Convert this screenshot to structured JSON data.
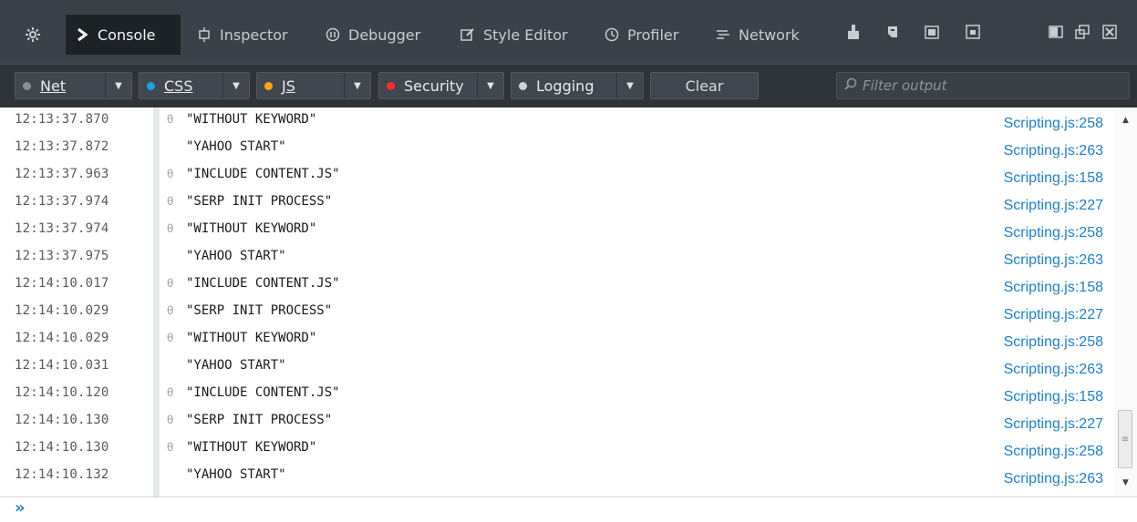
{
  "tabs": [
    {
      "name": "settings",
      "label": "",
      "icon": "gear-icon"
    },
    {
      "name": "console",
      "label": "Console",
      "icon": "chevron-right-icon",
      "selected": true
    },
    {
      "name": "inspector",
      "label": "Inspector",
      "icon": "inspector-icon"
    },
    {
      "name": "debugger",
      "label": "Debugger",
      "icon": "debugger-icon"
    },
    {
      "name": "style-editor",
      "label": "Style Editor",
      "icon": "pencil-icon"
    },
    {
      "name": "profiler",
      "label": "Profiler",
      "icon": "clock-icon"
    },
    {
      "name": "network",
      "label": "Network",
      "icon": "network-icon"
    }
  ],
  "filters": {
    "net": {
      "label": "Net",
      "dot_color": "#8b9096"
    },
    "css": {
      "label": "CSS",
      "dot_color": "#1ba1e2"
    },
    "js": {
      "label": "JS",
      "dot_color": "#ffa31a"
    },
    "security": {
      "label": "Security",
      "dot_color": "#ff2d2d"
    },
    "logging": {
      "label": "Logging",
      "dot_color": "#cfd3d6"
    }
  },
  "clear_label": "Clear",
  "filter_placeholder": "Filter output",
  "log": [
    {
      "time": "12:13:37.870",
      "icon": true,
      "message": "\"WITHOUT KEYWORD\"",
      "source": "Scripting.js:258"
    },
    {
      "time": "12:13:37.872",
      "icon": false,
      "message": "\"YAHOO START\"",
      "source": "Scripting.js:263"
    },
    {
      "time": "12:13:37.963",
      "icon": true,
      "message": "\"INCLUDE CONTENT.JS\"",
      "source": "Scripting.js:158"
    },
    {
      "time": "12:13:37.974",
      "icon": true,
      "message": "\"SERP INIT PROCESS\"",
      "source": "Scripting.js:227"
    },
    {
      "time": "12:13:37.974",
      "icon": true,
      "message": "\"WITHOUT KEYWORD\"",
      "source": "Scripting.js:258"
    },
    {
      "time": "12:13:37.975",
      "icon": false,
      "message": "\"YAHOO START\"",
      "source": "Scripting.js:263"
    },
    {
      "time": "12:14:10.017",
      "icon": true,
      "message": "\"INCLUDE CONTENT.JS\"",
      "source": "Scripting.js:158"
    },
    {
      "time": "12:14:10.029",
      "icon": true,
      "message": "\"SERP INIT PROCESS\"",
      "source": "Scripting.js:227"
    },
    {
      "time": "12:14:10.029",
      "icon": true,
      "message": "\"WITHOUT KEYWORD\"",
      "source": "Scripting.js:258"
    },
    {
      "time": "12:14:10.031",
      "icon": false,
      "message": "\"YAHOO START\"",
      "source": "Scripting.js:263"
    },
    {
      "time": "12:14:10.120",
      "icon": true,
      "message": "\"INCLUDE CONTENT.JS\"",
      "source": "Scripting.js:158"
    },
    {
      "time": "12:14:10.130",
      "icon": true,
      "message": "\"SERP INIT PROCESS\"",
      "source": "Scripting.js:227"
    },
    {
      "time": "12:14:10.130",
      "icon": true,
      "message": "\"WITHOUT KEYWORD\"",
      "source": "Scripting.js:258"
    },
    {
      "time": "12:14:10.132",
      "icon": false,
      "message": "\"YAHOO START\"",
      "source": "Scripting.js:263"
    }
  ]
}
